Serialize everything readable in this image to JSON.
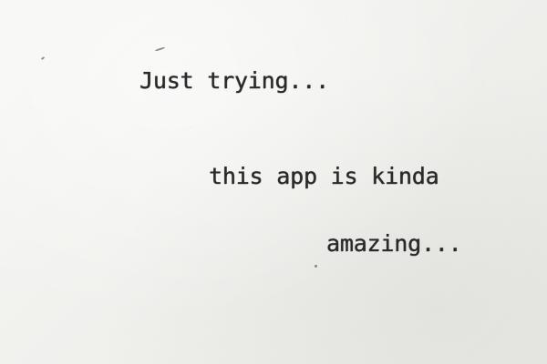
{
  "note": {
    "lines": [
      "Just trying...",
      "this app is kinda",
      "amazing..."
    ]
  },
  "colors": {
    "paper": "#f3f3f1",
    "ink": "#2a2a2a"
  }
}
